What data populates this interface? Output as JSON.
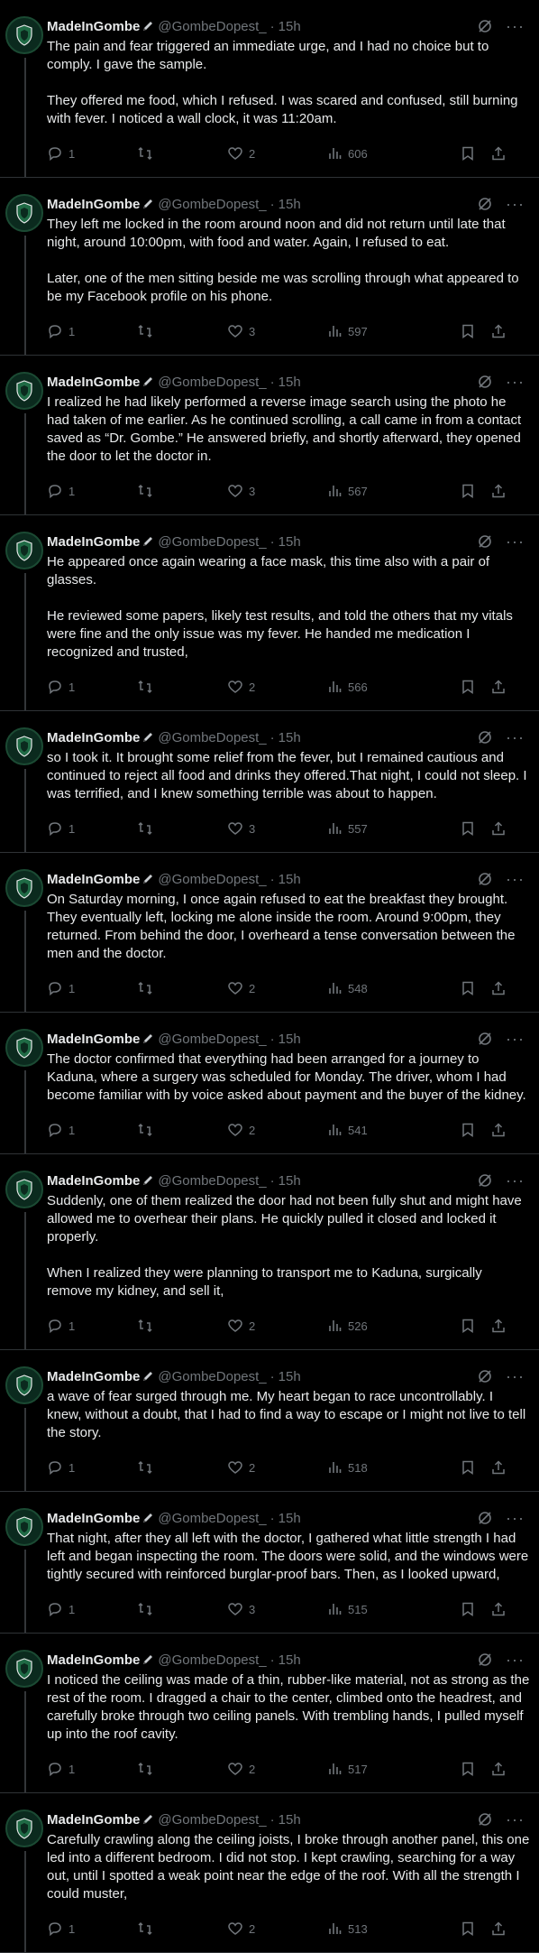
{
  "author": {
    "name": "MadeInGombe",
    "handle": "@GombeDopest_",
    "time": "15h",
    "separator": "·"
  },
  "icons": {
    "avatar": "green-shield-avatar",
    "name_badge": "pen-emoji",
    "grok": "grok-icon",
    "more": "more-icon",
    "reply": "reply-icon",
    "retweet": "retweet-icon",
    "like": "heart-icon",
    "views": "views-icon",
    "bookmark": "bookmark-icon",
    "share": "share-icon"
  },
  "colors": {
    "background": "#000000",
    "text": "#e7e9ea",
    "muted": "#71767b",
    "border": "#2f3336",
    "avatar": "#0b2a1e"
  },
  "more_glyph": "···",
  "tweets": [
    {
      "paragraphs": [
        "The pain and fear triggered an immediate urge, and I had no choice but to comply. I gave the sample.",
        "They offered me food, which I refused. I was scared and confused, still burning with fever. I noticed a wall clock, it was 11:20am."
      ],
      "replies": "1",
      "likes": "2",
      "views": "606"
    },
    {
      "paragraphs": [
        "They left me locked in the room around noon and did not return until late that night, around 10:00pm, with food and water. Again, I refused to eat.",
        "Later, one of the men sitting beside me was scrolling through what appeared to be my Facebook profile on his phone."
      ],
      "replies": "1",
      "likes": "3",
      "views": "597"
    },
    {
      "paragraphs": [
        "I realized he had likely performed a reverse image search using the photo he had taken of me earlier. As he continued scrolling, a call came in from a contact saved as “Dr. Gombe.” He answered briefly, and shortly afterward, they opened the door to let the doctor in."
      ],
      "replies": "1",
      "likes": "3",
      "views": "567"
    },
    {
      "paragraphs": [
        "He appeared once again wearing a face mask, this time also with a pair of glasses.",
        "He reviewed some papers, likely test results, and told the others that my vitals were fine and the only issue was my fever. He handed me medication I recognized and trusted,"
      ],
      "replies": "1",
      "likes": "2",
      "views": "566"
    },
    {
      "paragraphs": [
        "so I took it. It brought some relief from the fever, but I remained cautious and continued to reject all food and drinks they offered.That night, I could not sleep. I was terrified, and I knew something terrible was about to happen."
      ],
      "replies": "1",
      "likes": "3",
      "views": "557"
    },
    {
      "paragraphs": [
        "On Saturday morning, I once again refused to eat the breakfast they brought. They eventually left, locking me alone inside the room. Around 9:00pm, they returned. From behind the door, I overheard a tense conversation between the men and the doctor."
      ],
      "replies": "1",
      "likes": "2",
      "views": "548"
    },
    {
      "paragraphs": [
        "The doctor confirmed that everything had been arranged for a journey to Kaduna, where a surgery was scheduled for Monday. The driver, whom I had become familiar with by voice asked about payment and the buyer of the kidney."
      ],
      "replies": "1",
      "likes": "2",
      "views": "541"
    },
    {
      "paragraphs": [
        "Suddenly, one of them realized the door had not been fully shut and might have allowed me to overhear their plans. He quickly pulled it closed and locked it properly.",
        "When I realized they were planning to transport me to Kaduna, surgically remove my kidney, and sell it,"
      ],
      "replies": "1",
      "likes": "2",
      "views": "526"
    },
    {
      "paragraphs": [
        "a wave of fear surged through me. My heart began to race uncontrollably. I knew, without a doubt, that I had to find a way to escape or I might not live to tell the story."
      ],
      "replies": "1",
      "likes": "2",
      "views": "518"
    },
    {
      "paragraphs": [
        "That night, after they all left with the doctor, I gathered what little strength I had left and began inspecting the room. The doors were solid, and the windows were tightly secured with reinforced burglar-proof bars. Then, as I looked upward,"
      ],
      "replies": "1",
      "likes": "3",
      "views": "515"
    },
    {
      "paragraphs": [
        "I noticed the ceiling was made of a thin, rubber-like material, not as strong as the rest of the room. I dragged a chair to the center, climbed onto the headrest, and carefully broke through two ceiling panels. With trembling hands, I pulled myself up into the roof cavity."
      ],
      "replies": "1",
      "likes": "2",
      "views": "517"
    },
    {
      "paragraphs": [
        "Carefully crawling along the ceiling joists, I broke through another panel, this one led into a different bedroom. I did not stop. I kept crawling, searching for a way out, until I spotted a weak point near the edge of the roof. With all the strength I could muster,"
      ],
      "replies": "1",
      "likes": "2",
      "views": "513"
    }
  ]
}
